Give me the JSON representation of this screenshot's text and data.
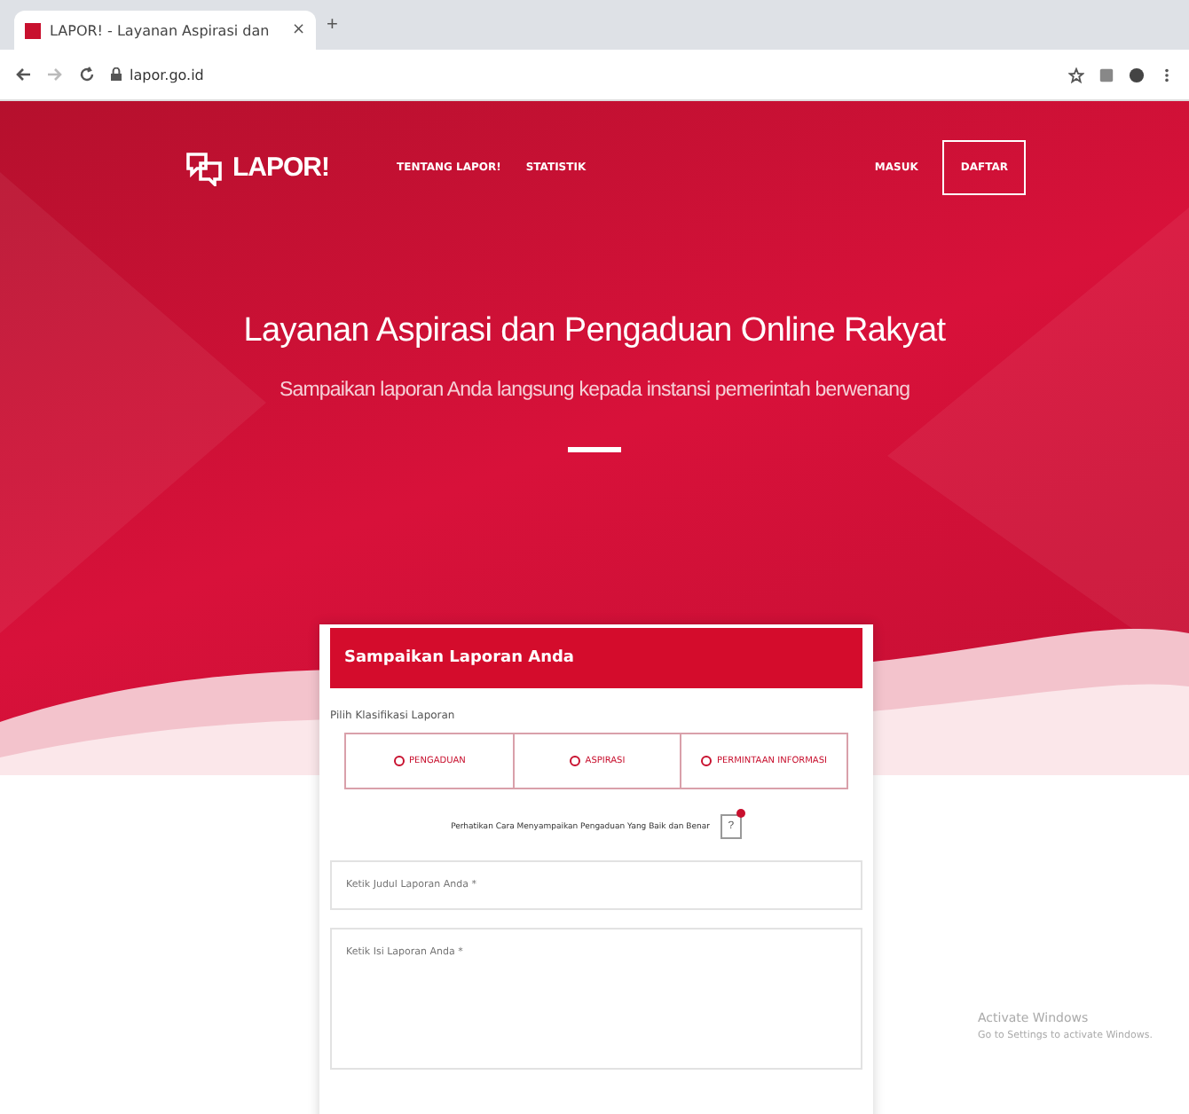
{
  "browser": {
    "tab_title": "LAPOR! - Layanan Aspirasi dan",
    "close_tab": "×",
    "new_tab": "+",
    "url": "lapor.go.id"
  },
  "navbar": {
    "logo": "LAPOR!",
    "links": [
      "TENTANG LAPOR!",
      "STATISTIK"
    ],
    "login": "MASUK",
    "register": "DAFTAR"
  },
  "hero": {
    "title": "Layanan Aspirasi dan Pengaduan Online Rakyat",
    "subtitle": "Sampaikan laporan Anda langsung kepada instansi pemerintah berwenang"
  },
  "form": {
    "header": "Sampaikan Laporan Anda",
    "classification_label": "Pilih Klasifikasi Laporan",
    "options": [
      {
        "label": "PENGADUAN",
        "selected": false
      },
      {
        "label": "ASPIRASI",
        "selected": false
      },
      {
        "label": "PERMINTAAN INFORMASI",
        "selected": false
      }
    ],
    "guide": "Perhatikan Cara Menyampaikan Pengaduan Yang Baik dan Benar",
    "help_button": "?",
    "title_field": {
      "placeholder": "Ketik Judul Laporan Anda *"
    },
    "body_field": {
      "placeholder": "Ketik Isi Laporan Anda *"
    }
  },
  "os_notice": {
    "title": "Activate Windows",
    "detail": "Go to Settings to activate Windows."
  }
}
